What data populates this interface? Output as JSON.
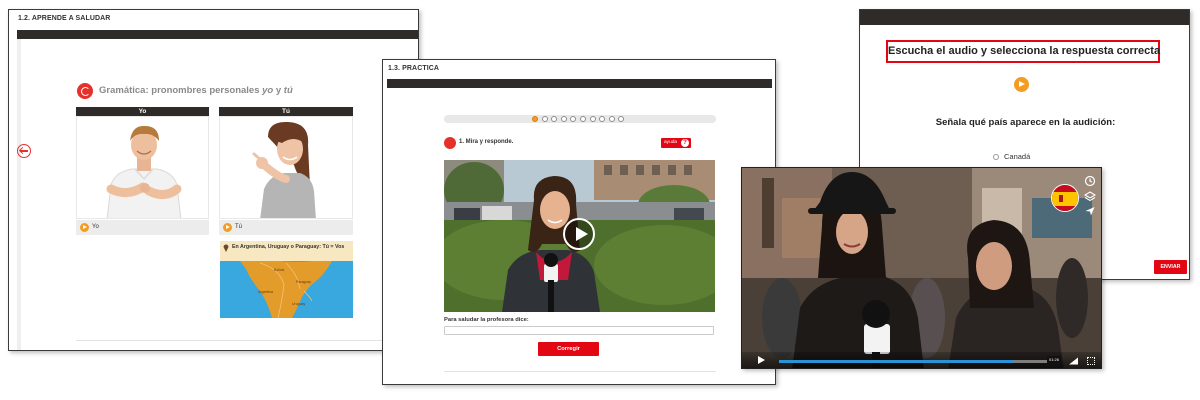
{
  "panel1": {
    "section_title": "1.2. APRENDE A SALUDAR",
    "grammar_title_prefix": "Gramática: pronombres personales ",
    "grammar_yo": "yo",
    "grammar_and": " y ",
    "grammar_tu": "tú",
    "col_yo": "Yo",
    "col_tu": "Tú",
    "audio_yo": "Yo",
    "audio_tu": "Tú",
    "map_note": "En Argentina, Uruguay o Paraguay: Tú = Vos",
    "map_labels": [
      "Bolivia",
      "Paraguay",
      "Argentina",
      "Uruguay"
    ]
  },
  "panel2": {
    "section_title": "1.3. PRACTICA",
    "exercise_title": "1. Mira y responde.",
    "help_label": "ayuda",
    "question": "Para saludar la profesora dice:",
    "answer_value": "",
    "check_button": "Corregir",
    "progress_total": 10,
    "progress_current": 1
  },
  "panel3": {
    "instruction": "Escucha el audio y selecciona la respuesta correcta",
    "question": "Señala qué país aparece en la audición:",
    "option": "Canadá",
    "send_button": "ENVIAR"
  },
  "panel4": {
    "time_tip": "01:26",
    "progress_fraction": 0.83
  },
  "colors": {
    "accent_red": "#e30613",
    "audio_orange": "#f49b22",
    "dark_bar": "#2f2b29",
    "map_sea": "#39a8df"
  }
}
